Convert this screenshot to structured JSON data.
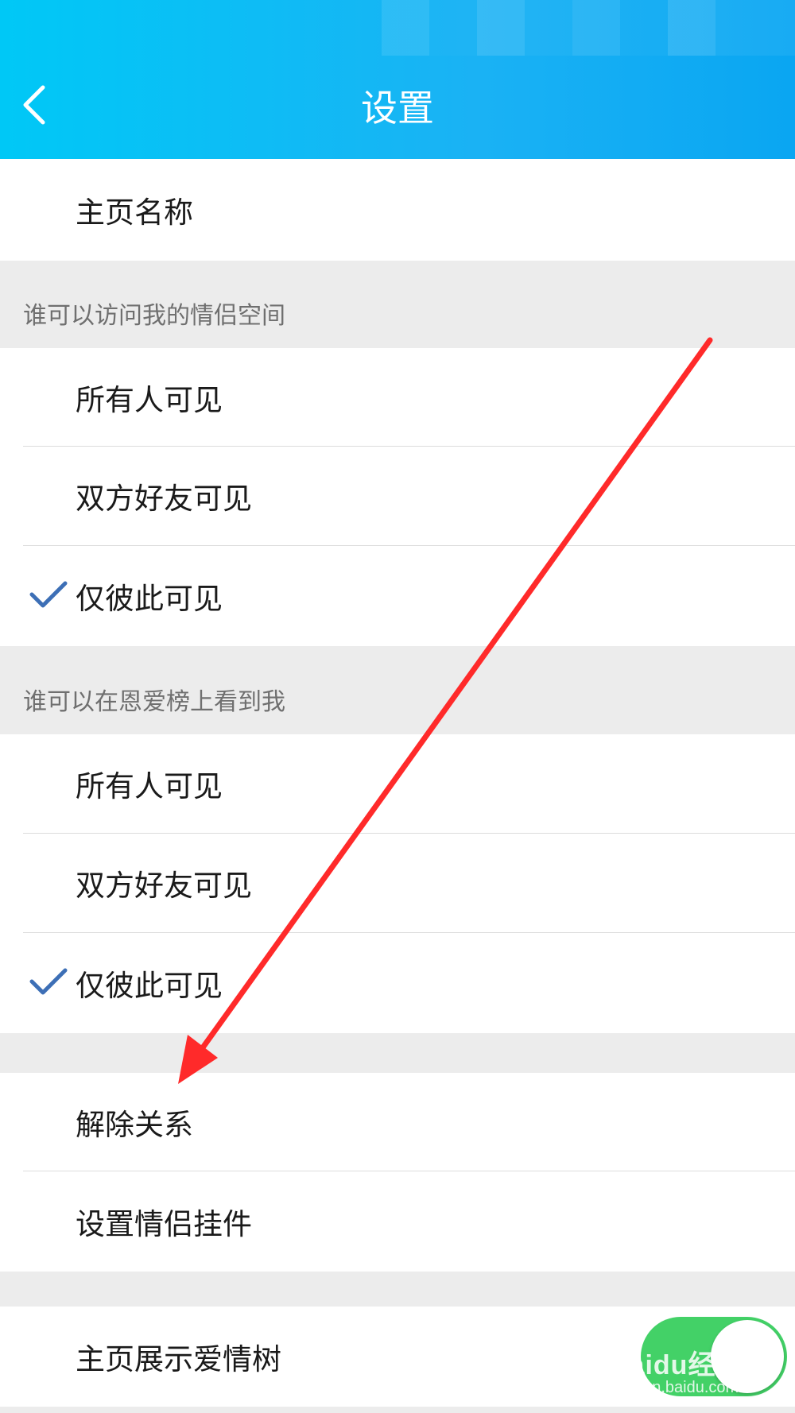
{
  "header": {
    "title": "设置",
    "back_icon": "chevron-left-icon",
    "gradient_colors": [
      "#00c8f6",
      "#0aa6f2"
    ]
  },
  "homepage_name": {
    "label": "主页名称"
  },
  "visit_section": {
    "header": "谁可以访问我的情侣空间",
    "options": [
      {
        "label": "所有人可见",
        "selected": false
      },
      {
        "label": "双方好友可见",
        "selected": false
      },
      {
        "label": "仅彼此可见",
        "selected": true
      }
    ]
  },
  "rank_section": {
    "header": "谁可以在恩爱榜上看到我",
    "options": [
      {
        "label": "所有人可见",
        "selected": false
      },
      {
        "label": "双方好友可见",
        "selected": false
      },
      {
        "label": "仅彼此可见",
        "selected": true
      }
    ]
  },
  "actions": {
    "unbind": "解除关系",
    "widget": "设置情侣挂件"
  },
  "love_tree": {
    "label": "主页展示爱情树",
    "enabled": true,
    "toggle_color": "#43d167"
  },
  "check_color": "#3d6fb6",
  "annotation_arrow_color": "#ff2a2a",
  "watermark": {
    "brand": "Baidu经验",
    "url": "jingyan.baidu.com"
  }
}
